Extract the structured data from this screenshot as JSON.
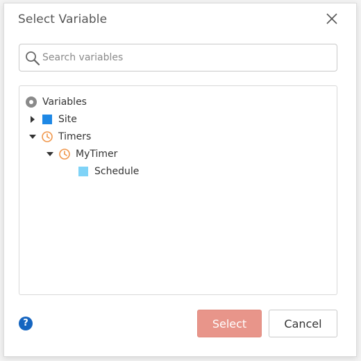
{
  "dialog": {
    "title": "Select Variable",
    "close_icon": "close-icon"
  },
  "search": {
    "placeholder": "Search variables",
    "value": "",
    "icon": "search-icon"
  },
  "tree": {
    "root": {
      "label": "Variables",
      "icon": "radio-circle-icon"
    },
    "items": [
      {
        "label": "Site",
        "icon": "square-icon",
        "color": "#1e88e5",
        "state": "collapsed"
      },
      {
        "label": "Timers",
        "icon": "clock-icon",
        "color": "#f0964a",
        "state": "expanded"
      },
      {
        "label": "MyTimer",
        "icon": "clock-icon",
        "color": "#f0964a",
        "state": "expanded"
      },
      {
        "label": "Schedule",
        "icon": "square-icon",
        "color": "#7fd3f7",
        "state": "leaf"
      }
    ]
  },
  "footer": {
    "help_label": "?",
    "select_label": "Select",
    "cancel_label": "Cancel"
  },
  "colors": {
    "select_button": "#e8958a",
    "help_icon": "#1565c0"
  }
}
